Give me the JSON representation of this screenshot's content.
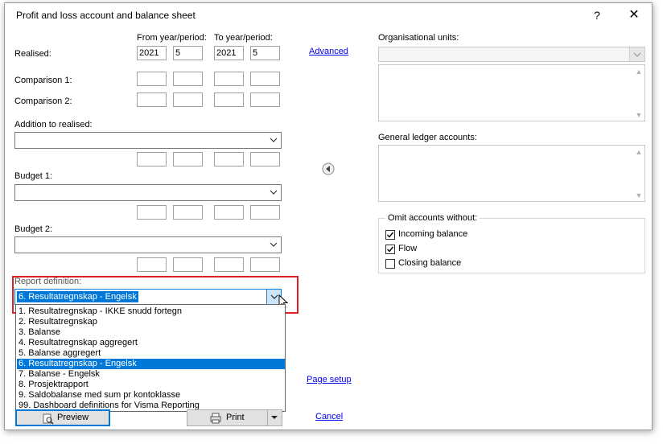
{
  "dialog": {
    "title": "Profit and loss account and balance sheet",
    "help_label": "?",
    "close_label": "✕"
  },
  "periods": {
    "from_header": "From year/period:",
    "to_header": "To year/period:",
    "realised_label": "Realised:",
    "realised_from_year": "2021",
    "realised_from_period": "5",
    "realised_to_year": "2021",
    "realised_to_period": "5",
    "comparison1_label": "Comparison 1:",
    "comparison2_label": "Comparison 2:",
    "addition_label": "Addition to realised:",
    "budget1_label": "Budget 1:",
    "budget2_label": "Budget 2:",
    "advanced_link": "Advanced"
  },
  "report": {
    "label": "Report definition:",
    "selected": "6. Resultatregnskap - Engelsk",
    "options": [
      "1. Resultatregnskap - IKKE snudd fortegn",
      "2. Resultatregnskap",
      "3. Balanse",
      "4. Resultatregnskap aggregert",
      "5. Balanse aggregert",
      "6. Resultatregnskap - Engelsk",
      "7. Balanse - Engelsk",
      "8. Prosjektrapport",
      "9. Saldobalanse med sum pr kontoklasse",
      "99. Dashboard definitions for Visma Reporting"
    ],
    "selected_index": 5
  },
  "right_panel": {
    "org_units_label": "Organisational units:",
    "gl_accounts_label": "General ledger accounts:",
    "omit_label": "Omit accounts without:",
    "incoming_balance": "Incoming balance",
    "incoming_checked": true,
    "flow": "Flow",
    "flow_checked": true,
    "closing_balance": "Closing balance",
    "closing_checked": false
  },
  "buttons": {
    "preview": "Preview",
    "print": "Print",
    "page_setup": "Page setup",
    "cancel": "Cancel"
  },
  "colors": {
    "selection": "#0078d7",
    "highlight_border": "#e02020",
    "link": "#0000ee"
  }
}
